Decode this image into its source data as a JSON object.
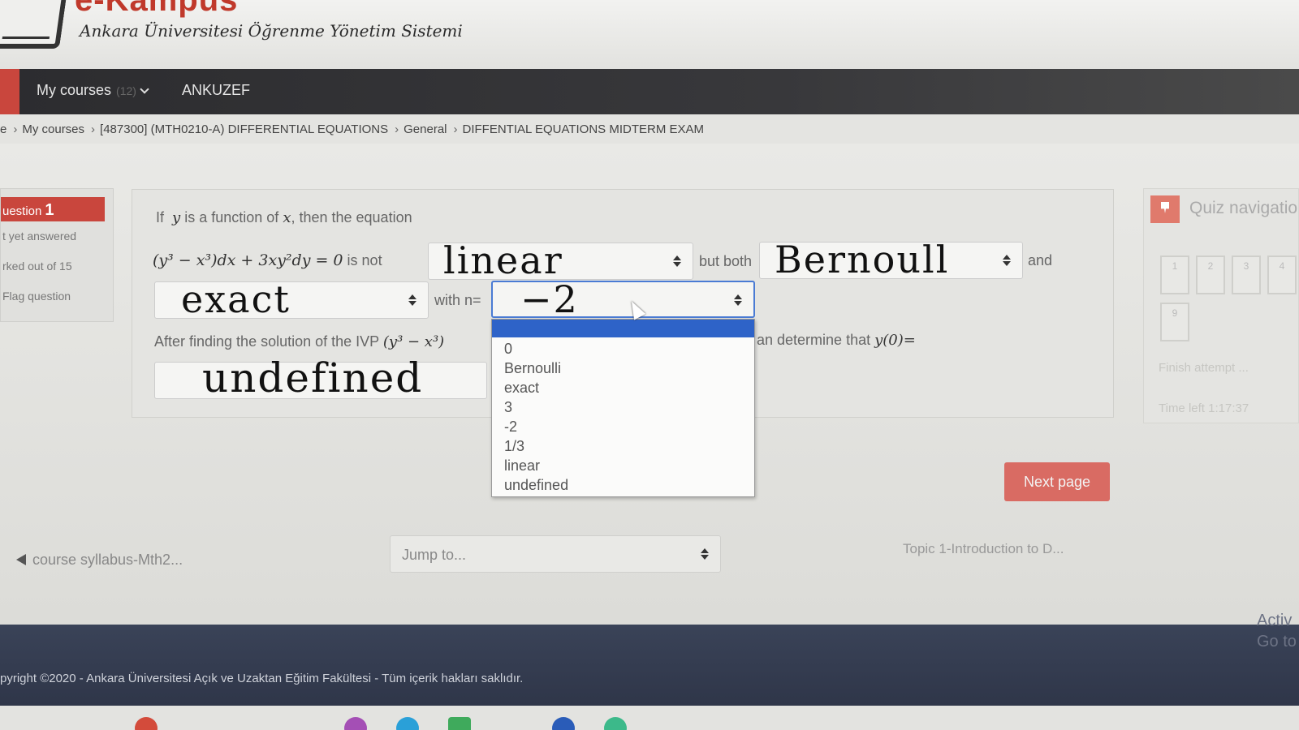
{
  "header": {
    "logo_title": "e-Kampus",
    "logo_subtitle": "Ankara Üniversitesi Öğrenme Yönetim Sistemi"
  },
  "navbar": {
    "my_courses": "My courses",
    "my_courses_count": "(12)",
    "ankuzef": "ANKUZEF"
  },
  "breadcrumb": [
    "e",
    "My courses",
    "[487300] (MTH0210-A) DIFFERENTIAL EQUATIONS",
    "General",
    "DIFFENTIAL EQUATIONS MIDTERM EXAM"
  ],
  "question_info": {
    "label": "uestion",
    "number": "1",
    "status": "t yet answered",
    "marks": "rked out of 15",
    "flag": "Flag question"
  },
  "question": {
    "line1_prefix": "If",
    "var_y": "y",
    "line1_mid": "is a function of",
    "var_x": "x",
    "line1_suffix": ", then the equation",
    "equation": "(y³ − x³)dx + 3xy²dy = 0",
    "is_not": "is  not",
    "select1_value": "linear",
    "but_both": "but both",
    "select2_value": "Bernoull",
    "and": "and",
    "select3_value": "exact",
    "with_n": "with n=",
    "select4_value": "−2",
    "ivp_prefix": "After finding the solution of the IVP",
    "ivp_math": "(y³ − x³)",
    "ivp_suffix": "an determine that",
    "ivp_y0": "y(0)=",
    "select5_value": "undefined"
  },
  "dropdown_options": [
    "",
    "0",
    "Bernoulli",
    "exact",
    "3",
    "-2",
    "1/3",
    "linear",
    "undefined"
  ],
  "quiz_nav": {
    "title": "Quiz navigatio",
    "boxes": [
      "1",
      "2",
      "3",
      "4",
      "9"
    ],
    "finish": "Finish attempt ...",
    "time_left": "Time left 1:17:37"
  },
  "next_page": "Next page",
  "bottom_nav": {
    "prev": "course syllabus-Mth2...",
    "jump_to": "Jump to...",
    "next": "Topic 1-Introduction to D..."
  },
  "footer": {
    "copyright": "pyright ©2020 - Ankara Üniversitesi Açık ve Uzaktan Eğitim Fakültesi - Tüm içerik hakları saklıdır.",
    "activate_1": "Activ",
    "activate_2": "Go to"
  },
  "colors": {
    "accent_red": "#c9463d",
    "navbar": "#2c2c2f",
    "highlight_blue": "#2e63c8",
    "footer": "#3a4358"
  }
}
